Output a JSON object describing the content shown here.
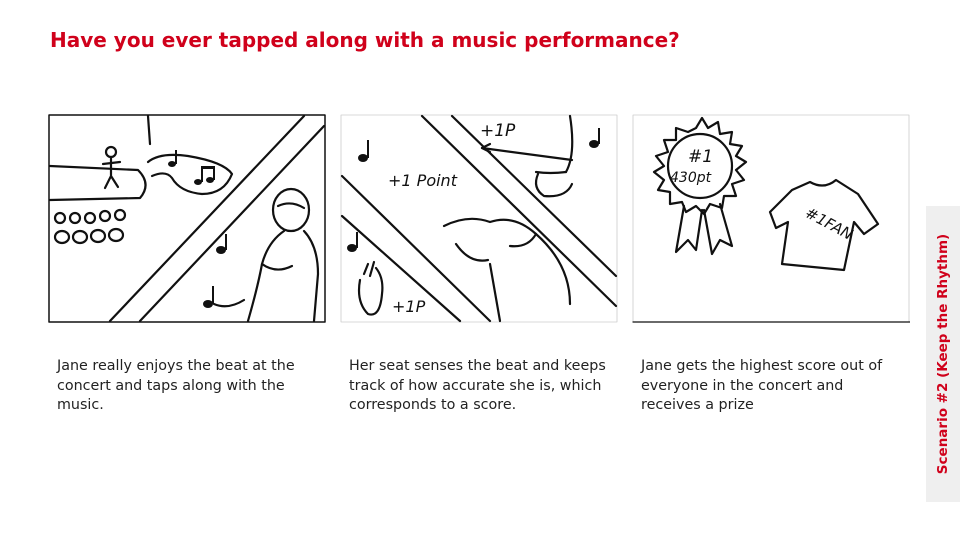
{
  "slide": {
    "title": "Have you ever tapped along with a music performance?",
    "side_label": "Scenario #2 (Keep the Rhythm)",
    "accent_color": "#d0011b"
  },
  "panels": [
    {
      "caption": "Jane really enjoys the beat at the concert and taps along with the music."
    },
    {
      "caption": "Her seat senses the beat and keeps track of how accurate she is, which corresponds to a score.",
      "sketch_text": [
        "+1P",
        "+1 Point",
        "+1P"
      ]
    },
    {
      "caption": "Jane gets the highest score out of everyone in the concert and receives a prize",
      "sketch_text": [
        "#1",
        "430pt",
        "#1FAN"
      ]
    }
  ]
}
